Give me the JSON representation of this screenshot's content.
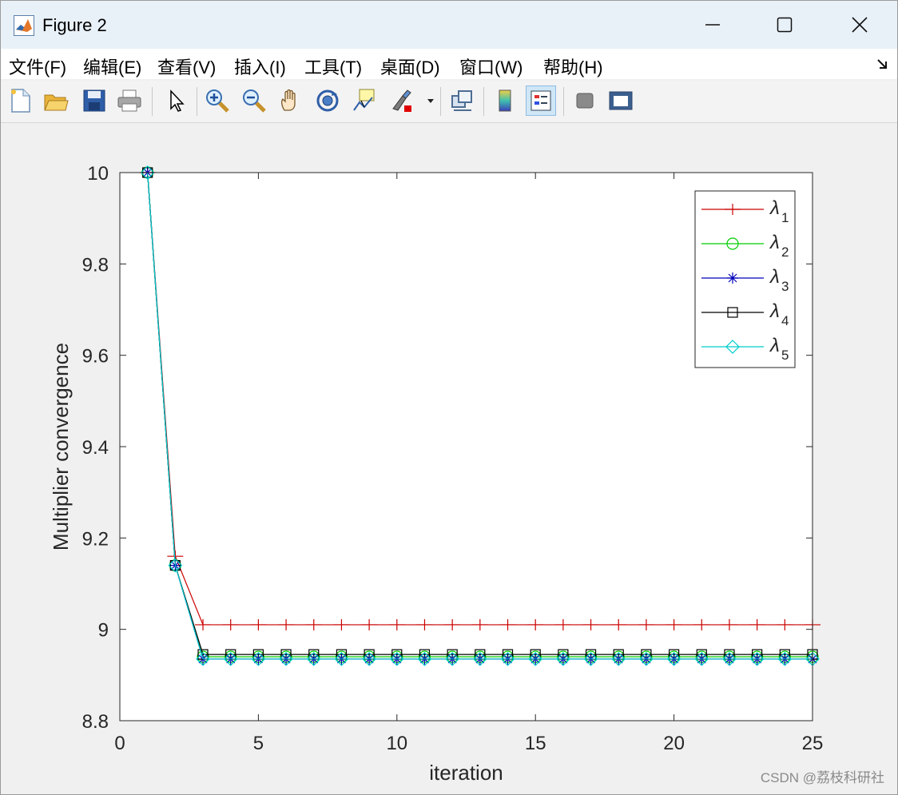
{
  "window": {
    "title": "Figure 2"
  },
  "menu": [
    "文件(F)",
    "编辑(E)",
    "查看(V)",
    "插入(I)",
    "工具(T)",
    "桌面(D)",
    "窗口(W)",
    "帮助(H)"
  ],
  "toolbar": [
    "new-figure",
    "open-file",
    "save",
    "print",
    "select-arrow",
    "zoom-in",
    "zoom-out",
    "pan",
    "rotate-3d",
    "data-cursor",
    "brush",
    "link-plot",
    "colorbar",
    "legend",
    "hide-plot-tools",
    "show-plot-tools"
  ],
  "watermark": "CSDN @荔枝科研社",
  "chart_data": {
    "type": "line",
    "xlabel": "iteration",
    "ylabel": "Multiplier convergence",
    "xlim": [
      0,
      25
    ],
    "ylim": [
      8.8,
      10
    ],
    "xticks": [
      0,
      5,
      10,
      15,
      20,
      25
    ],
    "yticks": [
      8.8,
      9,
      9.2,
      9.4,
      9.6,
      9.8,
      10
    ],
    "x": [
      1,
      2,
      3,
      4,
      5,
      6,
      7,
      8,
      9,
      10,
      11,
      12,
      13,
      14,
      15,
      16,
      17,
      18,
      19,
      20,
      21,
      22,
      23,
      24,
      25
    ],
    "legend_position": "top-right",
    "series": [
      {
        "name": "λ1",
        "sub": "1",
        "color": "#cc0000",
        "marker": "plus",
        "values": [
          10,
          9.16,
          9.01,
          9.01,
          9.01,
          9.01,
          9.01,
          9.01,
          9.01,
          9.01,
          9.01,
          9.01,
          9.01,
          9.01,
          9.01,
          9.01,
          9.01,
          9.01,
          9.01,
          9.01,
          9.01,
          9.01,
          9.01,
          9.01,
          9.01
        ]
      },
      {
        "name": "λ2",
        "sub": "2",
        "color": "#00cc00",
        "marker": "circle",
        "values": [
          10,
          9.14,
          8.94,
          8.94,
          8.94,
          8.94,
          8.94,
          8.94,
          8.94,
          8.94,
          8.94,
          8.94,
          8.94,
          8.94,
          8.94,
          8.94,
          8.94,
          8.94,
          8.94,
          8.94,
          8.94,
          8.94,
          8.94,
          8.94,
          8.94
        ]
      },
      {
        "name": "λ3",
        "sub": "3",
        "color": "#0000bb",
        "marker": "star",
        "values": [
          10,
          9.14,
          8.935,
          8.935,
          8.935,
          8.935,
          8.935,
          8.935,
          8.935,
          8.935,
          8.935,
          8.935,
          8.935,
          8.935,
          8.935,
          8.935,
          8.935,
          8.935,
          8.935,
          8.935,
          8.935,
          8.935,
          8.935,
          8.935,
          8.935
        ]
      },
      {
        "name": "λ4",
        "sub": "4",
        "color": "#000000",
        "marker": "square",
        "values": [
          10,
          9.14,
          8.945,
          8.945,
          8.945,
          8.945,
          8.945,
          8.945,
          8.945,
          8.945,
          8.945,
          8.945,
          8.945,
          8.945,
          8.945,
          8.945,
          8.945,
          8.945,
          8.945,
          8.945,
          8.945,
          8.945,
          8.945,
          8.945,
          8.945
        ]
      },
      {
        "name": "λ5",
        "sub": "5",
        "color": "#00cccc",
        "marker": "diamond",
        "values": [
          10,
          9.14,
          8.935,
          8.935,
          8.935,
          8.935,
          8.935,
          8.935,
          8.935,
          8.935,
          8.935,
          8.935,
          8.935,
          8.935,
          8.935,
          8.935,
          8.935,
          8.935,
          8.935,
          8.935,
          8.935,
          8.935,
          8.935,
          8.935,
          8.935
        ]
      }
    ]
  }
}
